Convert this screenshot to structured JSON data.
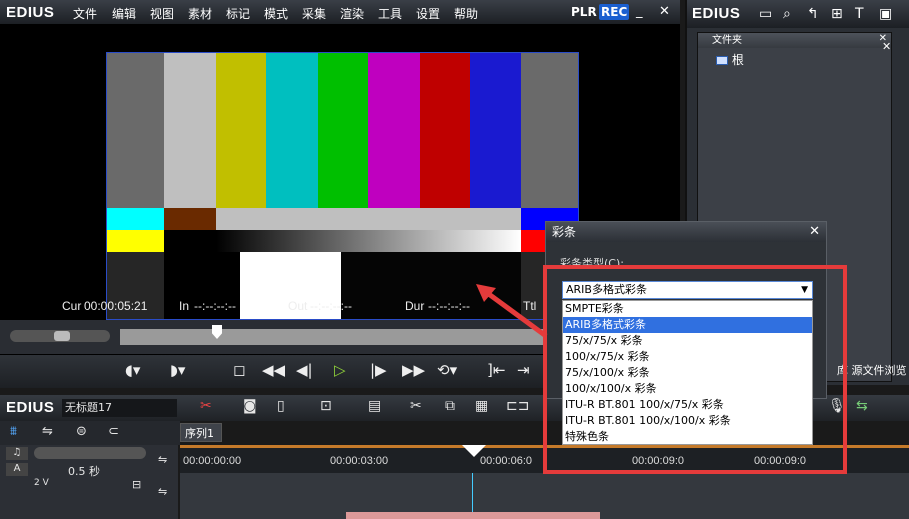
{
  "app": {
    "brand": "EDIUS",
    "menus": [
      "文件",
      "编辑",
      "视图",
      "素材",
      "标记",
      "模式",
      "采集",
      "渲染",
      "工具",
      "设置",
      "帮助"
    ],
    "plr": "PLR",
    "rec": "REC"
  },
  "monitor": {
    "cur_label": "Cur",
    "cur_value": "00:00:05:21",
    "in_label": "In",
    "in_value": "--:--:--:--",
    "out_label": "Out",
    "out_value": "--:--:--:--",
    "dur_label": "Dur",
    "dur_value": "--:--:--:--",
    "ttl_label": "Ttl"
  },
  "right_panel": {
    "brand": "EDIUS",
    "folder_title": "文件夹",
    "root_label": "根",
    "bottom_label": "库 源文件浏览"
  },
  "dialog": {
    "title": "彩条",
    "type_label": "彩条类型(C):",
    "selected": "ARIB多格式彩条",
    "options": [
      "SMPTE彩条",
      "ARIB多格式彩条",
      "75/x/75/x 彩条",
      "100/x/75/x 彩条",
      "75/x/100/x 彩条",
      "100/x/100/x 彩条",
      "ITU-R BT.801 100/x/75/x 彩条",
      "ITU-R BT.801 100/x/100/x 彩条",
      "特殊色条"
    ],
    "highlighted_index": 1
  },
  "timeline": {
    "brand": "EDIUS",
    "project_title": "无标题17",
    "sequence_tab": "序列1",
    "zoom": "0.5 秒",
    "track_label": "2 V",
    "ruler_labels": [
      "00:00:00:00",
      "00:00:03:00",
      "00:00:06:0",
      "00:00:09:0",
      "00:00:09:0"
    ]
  },
  "colors": {
    "accent": "#1a5fd0",
    "highlight_red": "#e53b3b",
    "play_green": "#8fd13a"
  }
}
